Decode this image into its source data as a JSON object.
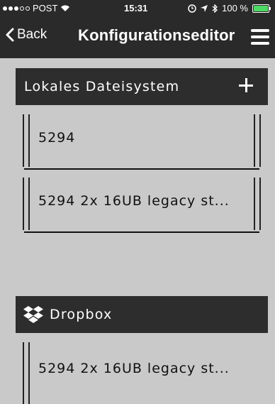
{
  "status_bar": {
    "carrier": "POST",
    "time": "15:31",
    "battery": "100 %"
  },
  "nav": {
    "back_label": "Back",
    "title": "Konfigurationseditor"
  },
  "local_section": {
    "title": "Lokales Dateisystem",
    "items": [
      {
        "label": "5294"
      },
      {
        "label": "5294 2x 16UB legacy st..."
      }
    ]
  },
  "dropbox_section": {
    "title": "Dropbox",
    "items": [
      {
        "label": "5294 2x 16UB legacy st..."
      }
    ]
  },
  "colors": {
    "header_bg": "#2a2a2a",
    "page_bg": "#c9c9c9",
    "battery": "#4cd964"
  }
}
